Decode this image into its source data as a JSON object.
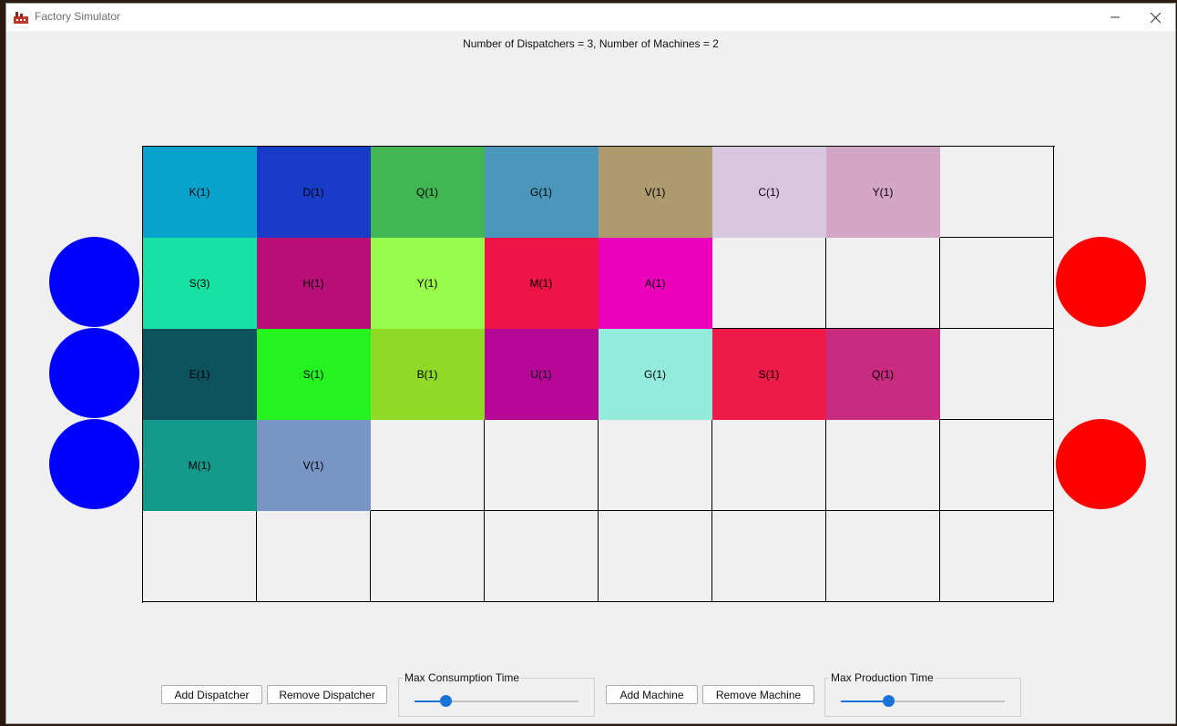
{
  "window": {
    "title": "Factory Simulator"
  },
  "status": {
    "text": "Number of Dispatchers = 3, Number of Machines = 2"
  },
  "dispatchers": 3,
  "machines": 2,
  "grid": {
    "rows": [
      [
        {
          "label": "K(1)",
          "color": "#08a3cc"
        },
        {
          "label": "D(1)",
          "color": "#193cc8"
        },
        {
          "label": "Q(1)",
          "color": "#41b652"
        },
        {
          "label": "G(1)",
          "color": "#4a97bb"
        },
        {
          "label": "V(1)",
          "color": "#ad9b6f"
        },
        {
          "label": "C(1)",
          "color": "#d8c6df"
        },
        {
          "label": "Y(1)",
          "color": "#d4a6c6"
        },
        {
          "label": "",
          "color": ""
        }
      ],
      [
        {
          "label": "S(3)",
          "color": "#17e2a4"
        },
        {
          "label": "H(1)",
          "color": "#b70f77"
        },
        {
          "label": "Y(1)",
          "color": "#99fb4a"
        },
        {
          "label": "M(1)",
          "color": "#ef1446"
        },
        {
          "label": "A(1)",
          "color": "#ec00bc"
        },
        {
          "label": "",
          "color": ""
        },
        {
          "label": "",
          "color": ""
        },
        {
          "label": "",
          "color": ""
        }
      ],
      [
        {
          "label": "E(1)",
          "color": "#0d535d"
        },
        {
          "label": "S(1)",
          "color": "#25f31f"
        },
        {
          "label": "B(1)",
          "color": "#8fd927"
        },
        {
          "label": "U(1)",
          "color": "#b60698"
        },
        {
          "label": "G(1)",
          "color": "#93ecdb"
        },
        {
          "label": "S(1)",
          "color": "#ee1a47"
        },
        {
          "label": "Q(1)",
          "color": "#c92b81"
        },
        {
          "label": "",
          "color": ""
        }
      ],
      [
        {
          "label": "M(1)",
          "color": "#139a8a"
        },
        {
          "label": "V(1)",
          "color": "#7995c3"
        },
        {
          "label": "",
          "color": ""
        },
        {
          "label": "",
          "color": ""
        },
        {
          "label": "",
          "color": ""
        },
        {
          "label": "",
          "color": ""
        },
        {
          "label": "",
          "color": ""
        },
        {
          "label": "",
          "color": ""
        }
      ],
      [
        {
          "label": "",
          "color": ""
        },
        {
          "label": "",
          "color": ""
        },
        {
          "label": "",
          "color": ""
        },
        {
          "label": "",
          "color": ""
        },
        {
          "label": "",
          "color": ""
        },
        {
          "label": "",
          "color": ""
        },
        {
          "label": "",
          "color": ""
        },
        {
          "label": "",
          "color": ""
        }
      ]
    ]
  },
  "controls": {
    "add_dispatcher": "Add Dispatcher",
    "remove_dispatcher": "Remove Dispatcher",
    "max_consumption_label": "Max Consumption Time",
    "max_consumption_value": 0.19,
    "add_machine": "Add Machine",
    "remove_machine": "Remove Machine",
    "max_production_label": "Max Production Time",
    "max_production_value": 0.29
  },
  "colors": {
    "dispatcher": "#0000ff",
    "machine": "#ff0000",
    "accent": "#1a73d9"
  }
}
